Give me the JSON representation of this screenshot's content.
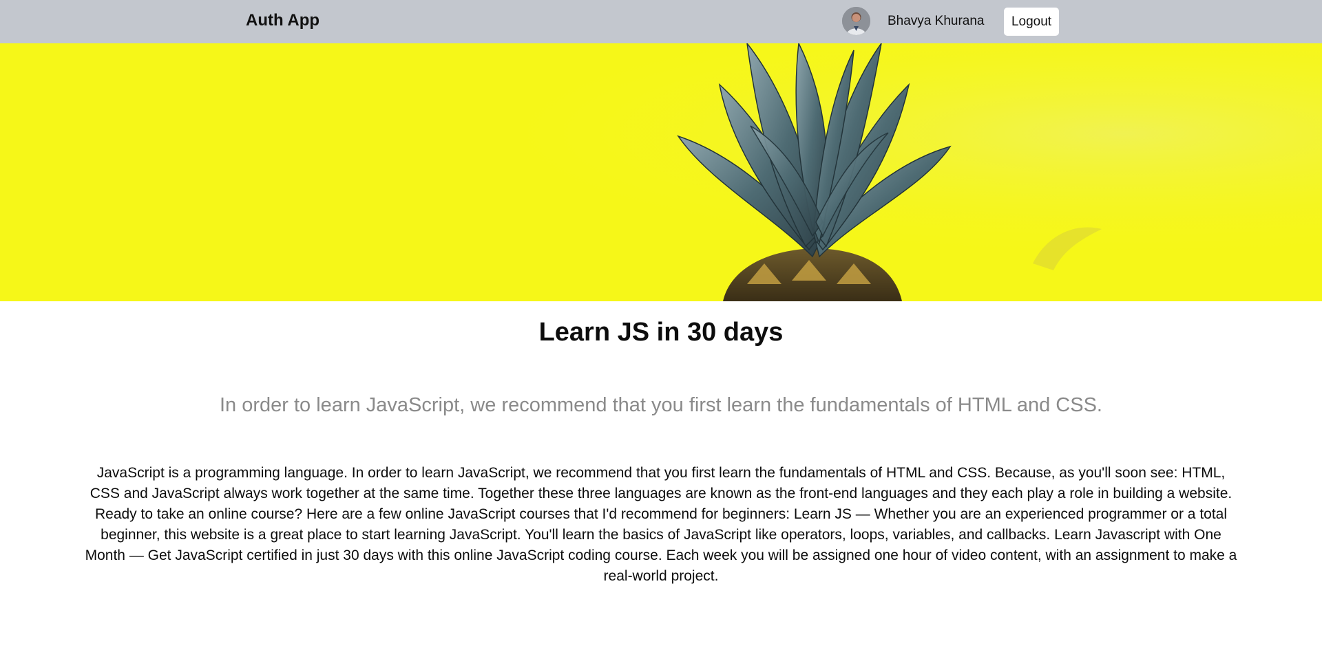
{
  "navbar": {
    "brand": "Auth App",
    "user_name": "Bhavya Khurana",
    "logout_label": "Logout",
    "avatar_icon": "user-avatar"
  },
  "banner": {
    "image": "pineapple-icon",
    "background_color": "#f6f718"
  },
  "content": {
    "title": "Learn JS in 30 days",
    "subtitle": "In order to learn JavaScript, we recommend that you first learn the fundamentals of HTML and CSS.",
    "body": "JavaScript is a programming language. In order to learn JavaScript, we recommend that you first learn the fundamentals of HTML and CSS. Because, as you'll soon see: HTML, CSS and JavaScript always work together at the same time. Together these three languages are known as the front-end languages and they each play a role in building a website. Ready to take an online course? Here are a few online JavaScript courses that I'd recommend for beginners: Learn JS — Whether you are an experienced programmer or a total beginner, this website is a great place to start learning JavaScript. You'll learn the basics of JavaScript like operators, loops, variables, and callbacks. Learn Javascript with One Month — Get JavaScript certified in just 30 days with this online JavaScript coding course. Each week you will be assigned one hour of video content, with an assignment to make a real-world project."
  },
  "colors": {
    "navbar_bg": "#c3c7ce",
    "banner_bg": "#f6f718",
    "subtitle_text": "#8a8a8a"
  }
}
